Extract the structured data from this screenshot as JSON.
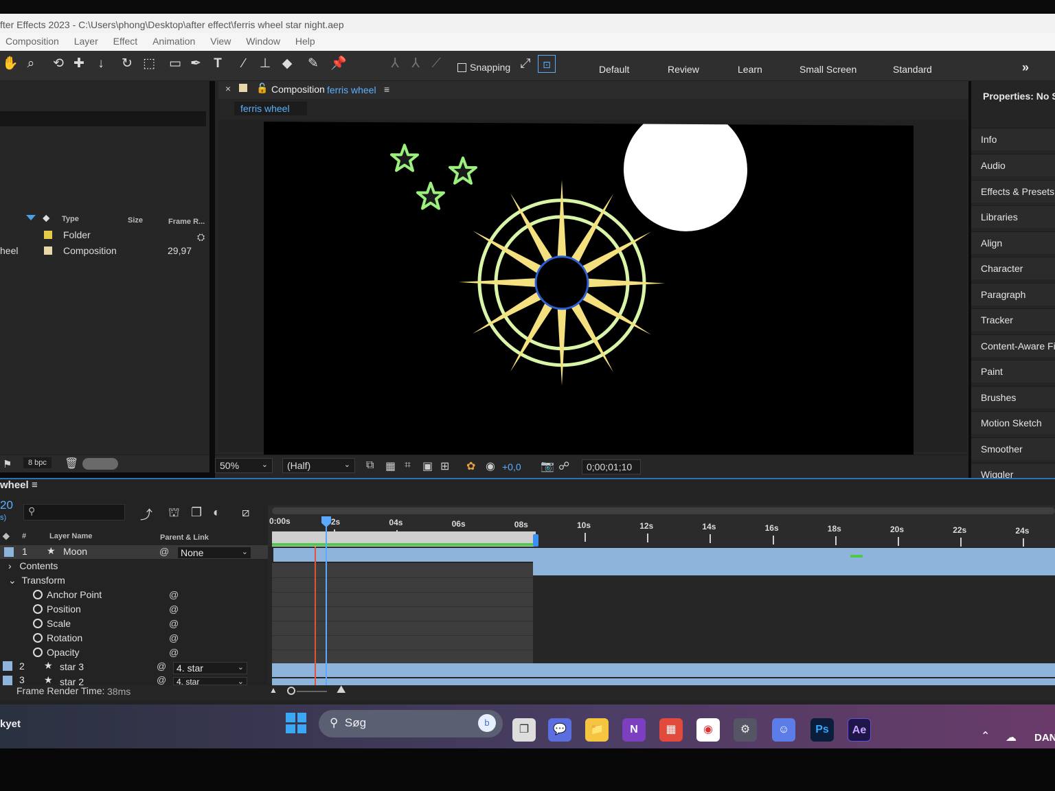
{
  "window": {
    "title": "fter Effects 2023 - C:\\Users\\phong\\Desktop\\after effect\\ferris wheel star night.aep"
  },
  "menu": [
    "Composition",
    "Layer",
    "Effect",
    "Animation",
    "View",
    "Window",
    "Help"
  ],
  "toolbar": {
    "snapping_label": "Snapping",
    "workspaces": [
      "Default",
      "Review",
      "Learn",
      "Small Screen",
      "Standard"
    ],
    "overflow": "»"
  },
  "project": {
    "columns": {
      "type": "Type",
      "size": "Size",
      "frame_rate": "Frame R..."
    },
    "items": [
      {
        "name": "",
        "type": "Folder",
        "frame_rate": "",
        "color": "#e6c84a"
      },
      {
        "name": "heel",
        "type": "Composition",
        "frame_rate": "29,97",
        "color": "#e8d8a8"
      }
    ],
    "bpc": "8 bpc"
  },
  "composition": {
    "tab_prefix": "Composition",
    "tab_name": "ferris wheel",
    "subtab": "ferris wheel",
    "zoom": "50%",
    "resolution": "(Half)",
    "exposure": "+0,0",
    "timecode": "0;00;01;10"
  },
  "properties_panel": {
    "title": "Properties: No Se",
    "items": [
      "Info",
      "Audio",
      "Effects & Presets",
      "Libraries",
      "Align",
      "Character",
      "Paragraph",
      "Tracker",
      "Content-Aware Fi",
      "Paint",
      "Brushes",
      "Motion Sketch",
      "Smoother",
      "Wiggler"
    ]
  },
  "timeline": {
    "comp_name": "wheel",
    "time_fragment": "20",
    "fps_fragment": "s)",
    "columns": {
      "num": "#",
      "layer_name": "Layer Name",
      "parent": "Parent & Link"
    },
    "ruler": [
      "0:00s",
      "02s",
      "04s",
      "06s",
      "08s",
      "10s",
      "12s",
      "14s",
      "16s",
      "18s",
      "20s",
      "22s",
      "24s"
    ],
    "layers": [
      {
        "num": "1",
        "name": "Moon",
        "parent": "None"
      },
      {
        "num": "2",
        "name": "star 3",
        "parent": "4. star"
      },
      {
        "num": "3",
        "name": "star 2",
        "parent": "4. star"
      }
    ],
    "groups": [
      "Contents",
      "Transform"
    ],
    "transform": [
      "Anchor Point",
      "Position",
      "Scale",
      "Rotation",
      "Opacity"
    ],
    "render_label": "Frame Render Time:",
    "render_value": "38ms"
  },
  "taskbar": {
    "search": "Søg",
    "apps": [
      "Ps",
      "Ae"
    ],
    "left_text": "kyet",
    "lang": "DAN"
  }
}
